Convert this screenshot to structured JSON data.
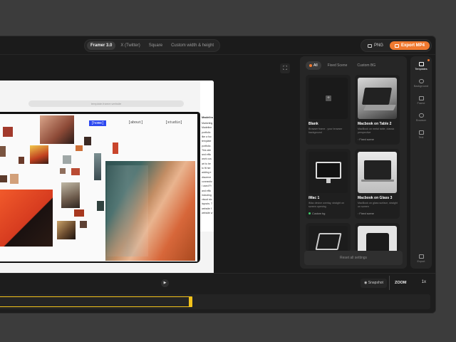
{
  "size_tabs": [
    "Framer 3.0",
    "X (Twitter)",
    "Square",
    "Custom width & height"
  ],
  "size_tab_active": "Framer 3.0",
  "export": {
    "png_label": "PNG",
    "mp4_label": "Export MP4"
  },
  "browser": {
    "url": "template.framer.website"
  },
  "site": {
    "nav_home": "[home]",
    "nav_about": "[about]",
    "nav_studio": "[studio]",
    "side_heading": "Madeline",
    "side_lines": [
      "Marketing",
      "Madeline",
      "portfolio",
      "like a foc",
      "template",
      "portfolio.",
      "This site",
      "and effic",
      "work cus",
      "art to be",
      "to fit her",
      "adding e",
      "discerne",
      "connectio",
      "I used Fr",
      "and effic",
      "including",
      "visual sto",
      "layouts. T",
      "website f",
      "website w"
    ]
  },
  "filters": [
    "All",
    "Fixed Scene",
    "Custom BG"
  ],
  "filter_active": "All",
  "templates": [
    {
      "title": "Blank",
      "desc": "Browser frame - your browser background",
      "tag": ""
    },
    {
      "title": "Macbook on Table 2",
      "desc": "MacBook on metal table, classic perspective",
      "tag": "Fixed scene"
    },
    {
      "title": "iMac 1",
      "desc": "iMac device overlay, straight on screen opening",
      "tag": "Custom bg"
    },
    {
      "title": "Macbook on Glass 3",
      "desc": "MacBook on glass surface, straight on screen",
      "tag": "Fixed scene"
    }
  ],
  "reset_label": "Reset all settings",
  "rail": [
    {
      "label": "Templates",
      "icon": "templates-icon",
      "active": true
    },
    {
      "label": "Background",
      "icon": "background-icon",
      "active": false
    },
    {
      "label": "Frame",
      "icon": "frame-icon",
      "active": false
    },
    {
      "label": "Browser",
      "icon": "browser-icon",
      "active": false
    },
    {
      "label": "Text",
      "icon": "text-icon",
      "active": false
    },
    {
      "label": "Export",
      "icon": "export-icon",
      "active": false
    }
  ],
  "snapshot_label": "Snapshot",
  "zoom": {
    "label": "ZOOM",
    "value": "1x"
  },
  "colors": {
    "accent": "#f0792f",
    "track": "#f2c21b",
    "panel": "#262626",
    "app_bg": "#1b1b1b"
  }
}
